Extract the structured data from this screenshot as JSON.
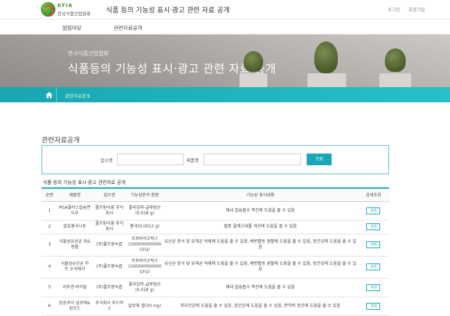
{
  "header": {
    "logo_en": "KFIA",
    "logo_ko": "한국식품산업협회",
    "site_title": "식품 등의 기능성 표시·광고 관련 자료 공개",
    "login": "로그인",
    "join": "회원가입"
  },
  "nav": {
    "items": [
      "알림마당",
      "관련자료공개"
    ]
  },
  "banner": {
    "subtitle": "한국식품산업협회",
    "title": "식품등의 기능성 표시·광고 관련 자료 공개"
  },
  "breadcrumb": {
    "current": "관련자료공개"
  },
  "section": {
    "title": "관련자료공개"
  },
  "search": {
    "company_label": "업소명",
    "product_label": "제품명",
    "button": "조회",
    "company_value": "",
    "product_value": ""
  },
  "table": {
    "caption": "식품 등의 기능성 표시·광고 관련자료 공개",
    "headers": [
      "순번",
      "제품명",
      "업소명",
      "기능성분과 함량",
      "기능성 표시내용",
      "상세조회"
    ],
    "view_label": "조회",
    "rows": [
      {
        "no": "1",
        "product": "PGA플러스칼슘면두부",
        "company": "풀무원식품 주식회사",
        "ingredient": "폴리감마-글루탐산 (0.018 g)",
        "claim": "체내 칼슘흡수 촉진에 도움을 줄 수 있음"
      },
      {
        "no": "2",
        "product": "발효홍국나토",
        "company": "풀무원식품 주식회사",
        "ingredient": "홍국(0.0012 g)",
        "claim": "혈중 콜레스테롤 개선에 도움을 줄 수 있음"
      },
      {
        "no": "3",
        "product": "식물성유산균 위&장활",
        "company": "(주)풀무원녹즙",
        "ingredient": "프로바이오틱스 (100000000000 CFU)",
        "claim": "유산균 증식 및 유해균 억제에 도움을 줄 수 있음, 배변활동 원활에 도움을 줄 수 있음, 장건강에 도움을 줄 수 있음"
      },
      {
        "no": "4",
        "product": "식물성유산균 하트 오곡애가",
        "company": "(주)풀무원녹즙",
        "ingredient": "프로바이오틱스 (100000000000 CFU)",
        "claim": "유산균 증식 및 유해균 억제에 도움을 줄 수 있음, 배변활동 원활에 도움을 줄 수 있음, 장건강에 도움을 줄 수 있음"
      },
      {
        "no": "5",
        "product": "리푸엔 바이탈",
        "company": "(주)풀무원녹즙",
        "ingredient": "폴리감마-글루탐산 (0.018 g)",
        "claim": "체내 칼슘흡수 촉진에 도움을 줄 수 있음"
      },
      {
        "no": "6",
        "product": "튼튼초이 알로에&정코드",
        "company": "주식회사 푸드머스",
        "ingredient": "알로에 겔(30 mg)",
        "claim": "피부건강에 도움을 줄 수 있음, 장건강에 도움을 줄 수 있음, 면역력 증진에 도움을 줄 수 있음"
      }
    ]
  }
}
